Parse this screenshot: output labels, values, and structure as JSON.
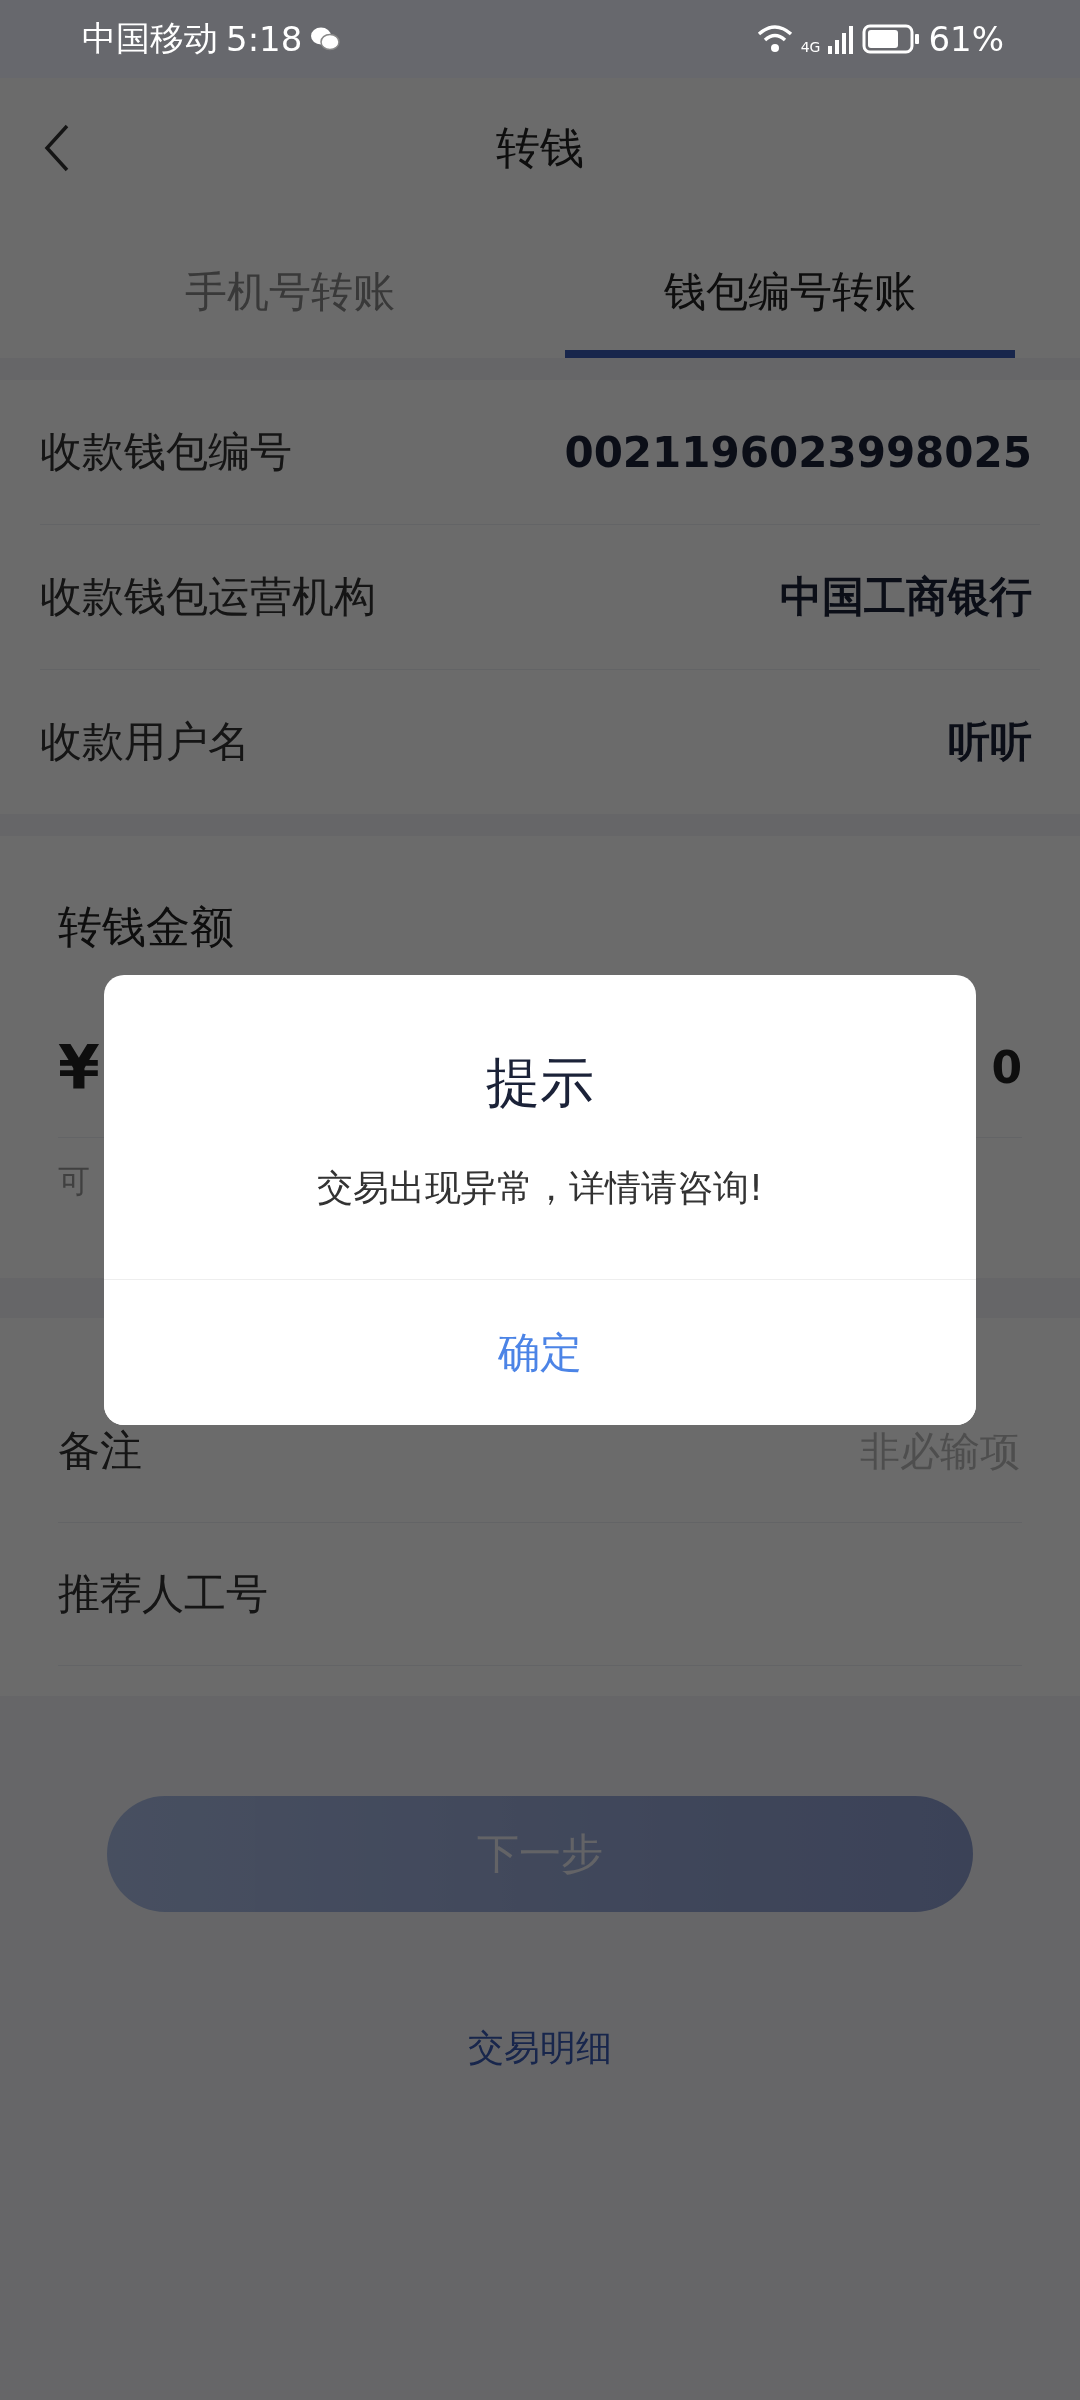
{
  "status_bar": {
    "carrier": "中国移动",
    "time": "5:18",
    "network": "4G",
    "battery": "61%"
  },
  "header": {
    "title": "转钱"
  },
  "tabs": [
    {
      "label": "手机号转账",
      "selected": false
    },
    {
      "label": "钱包编号转账",
      "selected": true
    }
  ],
  "payee": [
    {
      "label": "收款钱包编号",
      "value": "0021196023998025"
    },
    {
      "label": "收款钱包运营机构",
      "value": "中国工商银行"
    },
    {
      "label": "收款用户名",
      "value": "听听"
    }
  ],
  "amount": {
    "title": "转钱金额",
    "currency": "¥",
    "value": "0",
    "available": "可"
  },
  "extra_fields": [
    {
      "label": "备注",
      "placeholder": "非必输项"
    },
    {
      "label": "推荐人工号"
    }
  ],
  "next_button": {
    "label": "下一步",
    "disabled": true
  },
  "history_link": "交易明细",
  "dialog": {
    "title": "提示",
    "message": "交易出现异常，详情请咨询!",
    "button": "确定"
  }
}
